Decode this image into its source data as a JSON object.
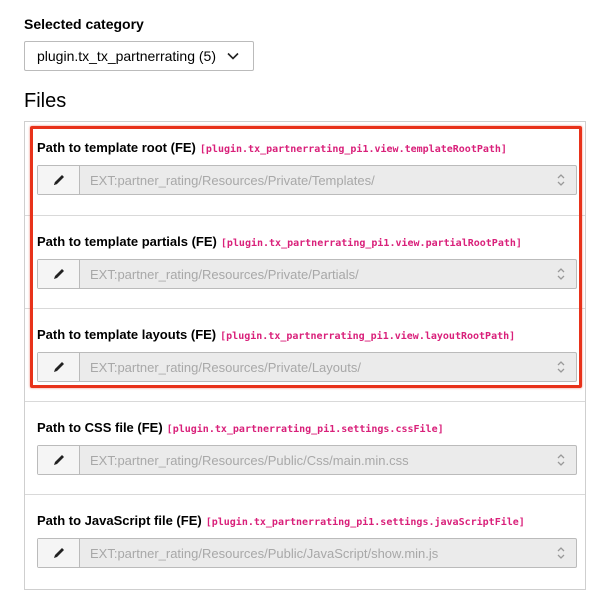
{
  "category": {
    "label": "Selected category",
    "selected": "plugin.tx_tx_partnerrating (5)"
  },
  "section_title": "Files",
  "fields": [
    {
      "title": "Path to template root (FE)",
      "key": "[plugin.tx_partnerrating_pi1.view.templateRootPath]",
      "value": "EXT:partner_rating/Resources/Private/Templates/"
    },
    {
      "title": "Path to template partials (FE)",
      "key": "[plugin.tx_partnerrating_pi1.view.partialRootPath]",
      "value": "EXT:partner_rating/Resources/Private/Partials/"
    },
    {
      "title": "Path to template layouts (FE)",
      "key": "[plugin.tx_partnerrating_pi1.view.layoutRootPath]",
      "value": "EXT:partner_rating/Resources/Private/Layouts/"
    },
    {
      "title": "Path to CSS file (FE)",
      "key": "[plugin.tx_partnerrating_pi1.settings.cssFile]",
      "value": "EXT:partner_rating/Resources/Public/Css/main.min.css"
    },
    {
      "title": "Path to JavaScript file (FE)",
      "key": "[plugin.tx_partnerrating_pi1.settings.javaScriptFile]",
      "value": "EXT:partner_rating/Resources/Public/JavaScript/show.min.js"
    }
  ],
  "colors": {
    "key_pink": "#d9207a",
    "highlight_red": "#e8321a",
    "disabled_field_bg": "#ebebeb"
  },
  "icons": {
    "select_arrow": "chevron-down-icon",
    "edit": "pencil-icon",
    "field_select": "sort-icon"
  }
}
